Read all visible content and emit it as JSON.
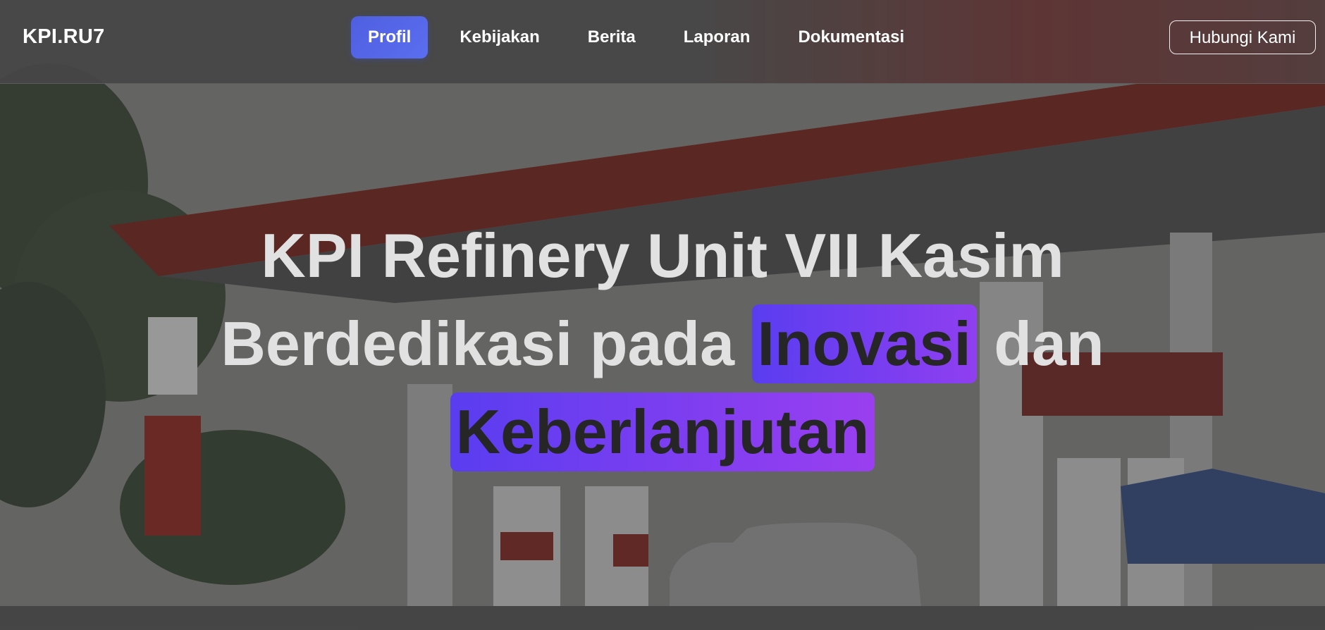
{
  "nav": {
    "brand": "KPI.RU7",
    "items": [
      {
        "label": "Profil",
        "active": true
      },
      {
        "label": "Kebijakan",
        "active": false
      },
      {
        "label": "Berita",
        "active": false
      },
      {
        "label": "Laporan",
        "active": false
      },
      {
        "label": "Dokumentasi",
        "active": false
      }
    ],
    "contact_label": "Hubungi Kami"
  },
  "hero": {
    "line1": "KPI Refinery Unit VII Kasim",
    "line2_prefix": "Berdedikasi pada",
    "line2_highlight": "Inovasi",
    "line2_suffix": "dan",
    "line3_highlight": "Keberlanjutan"
  },
  "colors": {
    "accent_start": "#4f5fe0",
    "highlight_start": "#5a3df0",
    "highlight_end": "#9a3ff0",
    "canopy_red": "#8e2a22"
  }
}
